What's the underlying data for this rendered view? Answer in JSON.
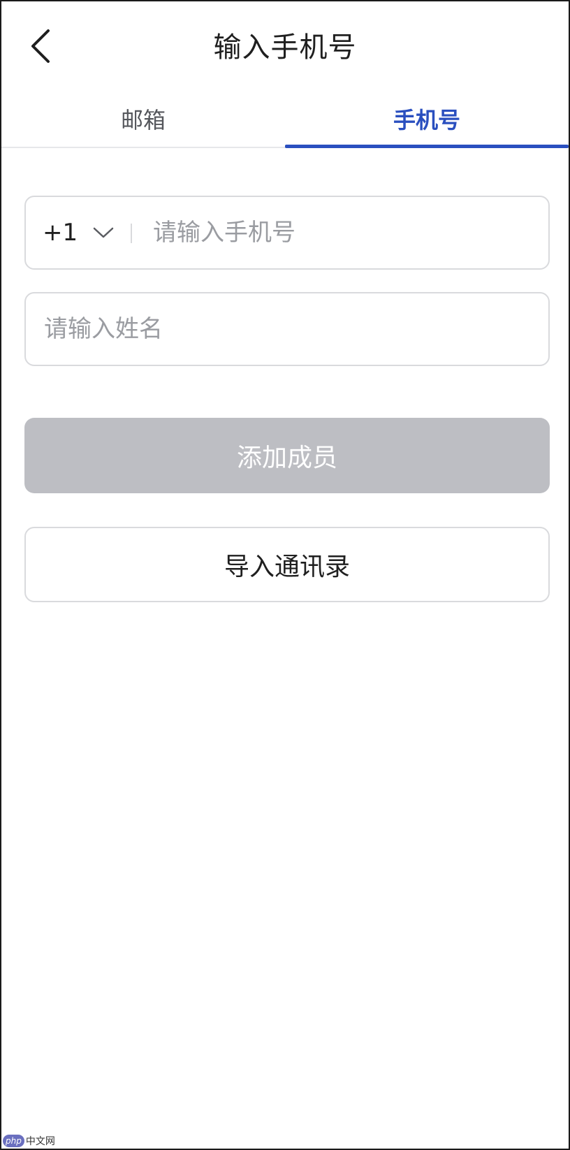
{
  "header": {
    "title": "输入手机号",
    "back_icon": "chevron-left-icon"
  },
  "tabs": [
    {
      "label": "邮箱",
      "active": false
    },
    {
      "label": "手机号",
      "active": true
    }
  ],
  "form": {
    "phone": {
      "country_code": "+1",
      "dropdown_icon": "chevron-down-icon",
      "placeholder": "请输入手机号",
      "value": ""
    },
    "name": {
      "placeholder": "请输入姓名",
      "value": ""
    }
  },
  "buttons": {
    "add_member": "添加成员",
    "import_contacts": "导入通讯录"
  },
  "colors": {
    "accent": "#2a4fbf",
    "disabled_button": "#bdbec3",
    "border": "#d9dadd",
    "placeholder": "#9a9ca1"
  },
  "watermark": {
    "logo_text": "php",
    "site_text": "中文网"
  }
}
